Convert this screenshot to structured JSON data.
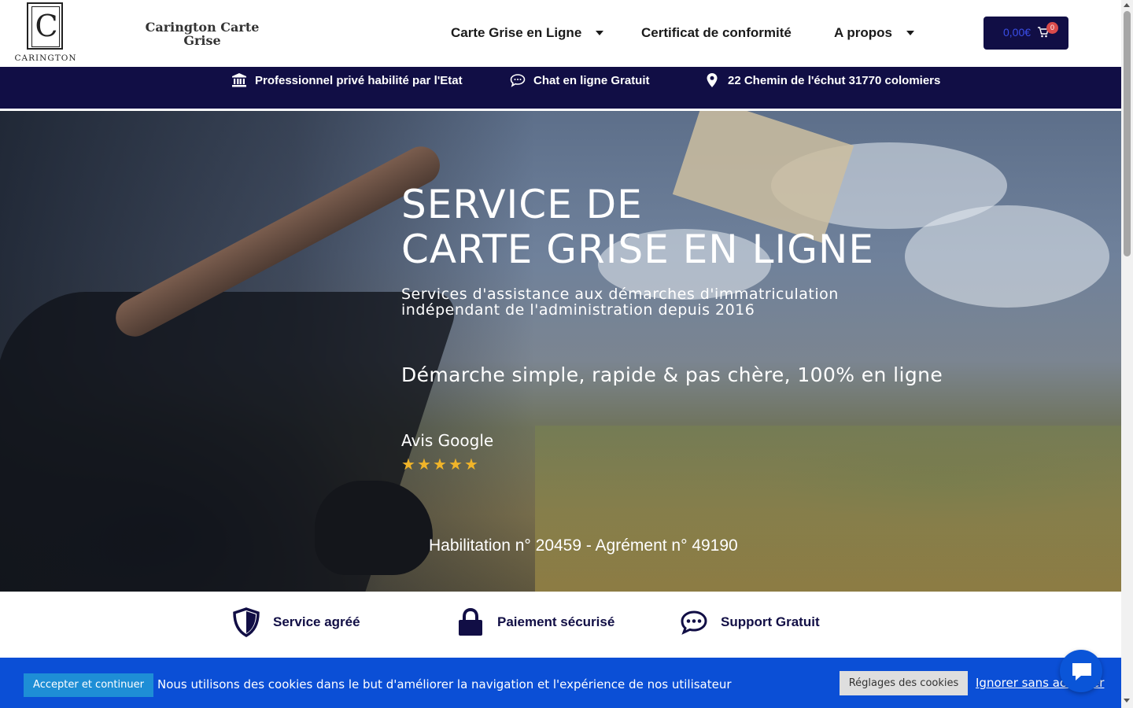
{
  "header": {
    "logo_letter": "C",
    "logo_word": "CARINGTON",
    "brand_name": "Carington Carte Grise",
    "nav": [
      {
        "label": "Carte Grise en Ligne",
        "has_dropdown": true
      },
      {
        "label": "Certificat de conformité",
        "has_dropdown": false
      },
      {
        "label": "A propos",
        "has_dropdown": true
      }
    ],
    "cart": {
      "total": "0,00€",
      "count": "0",
      "icon": "cart-icon"
    }
  },
  "infobar": [
    {
      "icon": "bank-icon",
      "label": "Professionnel privé habilité par l'Etat"
    },
    {
      "icon": "chat-bubble-icon",
      "label": "Chat en ligne Gratuit"
    },
    {
      "icon": "location-pin-icon",
      "label": "22 Chemin de l'échut 31770 colomiers"
    }
  ],
  "hero": {
    "title_line1": "SERVICE DE",
    "title_line2": "CARTE GRISE EN LIGNE",
    "subtitle_line1": "Services d'assistance aux démarches d'immatriculation",
    "subtitle_line2": "indépendant de l'administration depuis 2016",
    "tagline": "Démarche simple, rapide & pas chère, 100% en ligne",
    "reviews_label": "Avis Google",
    "rating": 5,
    "rating_max": 5,
    "star_glyph": "★",
    "accreditation": "Habilitation n° 20459 - Agrément n° 49190"
  },
  "features": [
    {
      "icon": "shield-icon",
      "label": "Service agréé"
    },
    {
      "icon": "lock-icon",
      "label": "Paiement sécurisé"
    },
    {
      "icon": "chat-dots-icon",
      "label": "Support Gratuit"
    }
  ],
  "cookie_bar": {
    "accept_label": "Accepter et continuer",
    "message": "Nous utilisons des cookies dans le but d'améliorer la navigation et l'expérience de nos utilisateur",
    "settings_label": "Réglages des cookies",
    "ignore_label": "Ignorer sans accepter"
  },
  "colors": {
    "navy": "#110e45",
    "cookie_blue": "#0b4fd6",
    "star": "#f0b429"
  }
}
